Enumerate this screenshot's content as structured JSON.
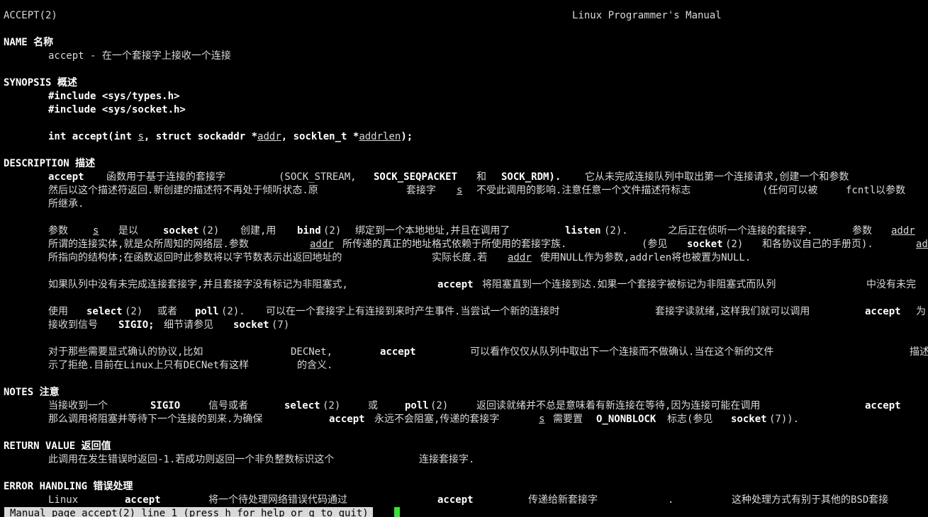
{
  "header": {
    "left": "ACCEPT(2)",
    "center": "Linux Programmer's Manual"
  },
  "sections": {
    "name": "NAME 名称",
    "synopsis": "SYNOPSIS 概述",
    "description": "DESCRIPTION 描述",
    "notes": "NOTES 注意",
    "return_value": "RETURN VALUE 返回值",
    "error_handling": "ERROR HANDLING 错误处理"
  },
  "name_line": "accept - 在一个套接字上接收一个连接",
  "synopsis": {
    "inc1": "#include <sys/types.h>",
    "inc2": "#include <sys/socket.h>",
    "p1": "int accept(int ",
    "s": "s",
    "p2": ", struct sockaddr *",
    "addr": "addr",
    "p3": ", socklen_t *",
    "addrlen": "addrlen",
    "p4": ");"
  },
  "desc": {
    "l1": [
      {
        "t": "accept"
      },
      {
        "t": "函数用于基于连接的套接字"
      },
      {
        "t": "(SOCK_STREAM,"
      },
      {
        "t": "SOCK_SEQPACKET"
      },
      {
        "t": "和"
      },
      {
        "t": "SOCK_RDM)."
      },
      {
        "t": "它从未完成连接队列中取出第一个连接请求,创建一个和参数"
      }
    ],
    "l2": [
      {
        "t": "然后以这个描述符返回.新创建的描述符不再处于倾听状态.原"
      },
      {
        "t": "套接字"
      },
      {
        "t": "s"
      },
      {
        "t": "不受此调用的影响.注意任意一个文件描述符标志"
      },
      {
        "t": "(任何可以被"
      },
      {
        "t": "fcntl以参数"
      }
    ],
    "l3": "所继承.",
    "p2a": [
      {
        "t": "参数"
      },
      {
        "t": "s"
      },
      {
        "t": "是以"
      },
      {
        "t": "socket"
      },
      {
        "t": "(2)"
      },
      {
        "t": "创建,用"
      },
      {
        "t": "bind"
      },
      {
        "t": "(2)"
      },
      {
        "t": "绑定到一个本地地址,并且在调用了"
      },
      {
        "t": "listen"
      },
      {
        "t": "(2)."
      },
      {
        "t": "之后正在侦听一个连接的套接字."
      },
      {
        "t": "参数"
      },
      {
        "t": "addr"
      }
    ],
    "p2b": [
      {
        "t": "所谓的连接实体,就是众所周知的网络层.参数"
      },
      {
        "t": "addr"
      },
      {
        "t": "所传递的真正的地址格式依赖于所使用的套接字族."
      },
      {
        "t": "(参见"
      },
      {
        "t": "socket"
      },
      {
        "t": "(2)"
      },
      {
        "t": "和各协议自己的手册页)."
      },
      {
        "t": "ad"
      }
    ],
    "p2c": [
      {
        "t": "所指向的结构体;在函数返回时此参数将以字节数表示出返回地址的"
      },
      {
        "t": "实际长度.若"
      },
      {
        "t": "addr"
      },
      {
        "t": "使用NULL作为参数,addrlen将也被置为NULL."
      }
    ],
    "p3": [
      {
        "t": "如果队列中没有未完成连接套接字,并且套接字没有标记为非阻塞式,"
      },
      {
        "t": "accept"
      },
      {
        "t": "将阻塞直到一个连接到达.如果一个套接字被标记为非阻塞式而队列"
      },
      {
        "t": "中没有未完"
      }
    ],
    "p4a": [
      {
        "t": "使用"
      },
      {
        "t": "select"
      },
      {
        "t": "(2)"
      },
      {
        "t": "或者"
      },
      {
        "t": "poll"
      },
      {
        "t": "(2)."
      },
      {
        "t": "可以在一个套接字上有连接到来时产生事件.当尝试一个新的连接时"
      },
      {
        "t": "套接字读就绪,这样我们就可以调用"
      },
      {
        "t": "accept"
      },
      {
        "t": "为"
      }
    ],
    "p4b": [
      {
        "t": "接收到信号"
      },
      {
        "t": "SIGIO;"
      },
      {
        "t": "细节请参见"
      },
      {
        "t": "socket"
      },
      {
        "t": "(7)"
      }
    ],
    "p5a": [
      {
        "t": "对于那些需要显式确认的协议,比如"
      },
      {
        "t": "DECNet,"
      },
      {
        "t": "accept"
      },
      {
        "t": "可以看作仅仅从队列中取出下一个连接而不做确认.当在这个新的文件"
      },
      {
        "t": "描述"
      }
    ],
    "p5b": [
      {
        "t": "示了拒绝.目前在Linux上只有DECNet有这样"
      },
      {
        "t": "的含义."
      }
    ]
  },
  "notes": {
    "l1": [
      {
        "t": "当接收到一个"
      },
      {
        "t": "SIGIO"
      },
      {
        "t": "信号或者"
      },
      {
        "t": "select"
      },
      {
        "t": "(2)"
      },
      {
        "t": "或"
      },
      {
        "t": "poll"
      },
      {
        "t": "(2)"
      },
      {
        "t": "返回读就绪并不总是意味着有新连接在等待,因为连接可能在调用"
      },
      {
        "t": "accept"
      }
    ],
    "l2": [
      {
        "t": "那么调用将阻塞并等待下一个连接的到来.为确保"
      },
      {
        "t": "accept"
      },
      {
        "t": "永远不会阻塞,传递的套接字"
      },
      {
        "t": "s"
      },
      {
        "t": "需要置"
      },
      {
        "t": "O_NONBLOCK"
      },
      {
        "t": "标志(参见"
      },
      {
        "t": "socket"
      },
      {
        "t": "(7))."
      }
    ]
  },
  "return_value": {
    "l1": [
      {
        "t": "此调用在发生错误时返回-1.若成功则返回一个非负整数标识这个"
      },
      {
        "t": "连接套接字."
      }
    ]
  },
  "error_handling": {
    "l1": [
      {
        "t": "Linux"
      },
      {
        "t": "accept"
      },
      {
        "t": "将一个待处理网络错误代码通过"
      },
      {
        "t": "accept"
      },
      {
        "t": "传递给新套接字"
      },
      {
        "t": "."
      },
      {
        "t": "这种处理方式有别于其他的BSD套接"
      }
    ]
  },
  "status_line": "Manual page accept(2) line 1 (press h for help or q to quit)"
}
